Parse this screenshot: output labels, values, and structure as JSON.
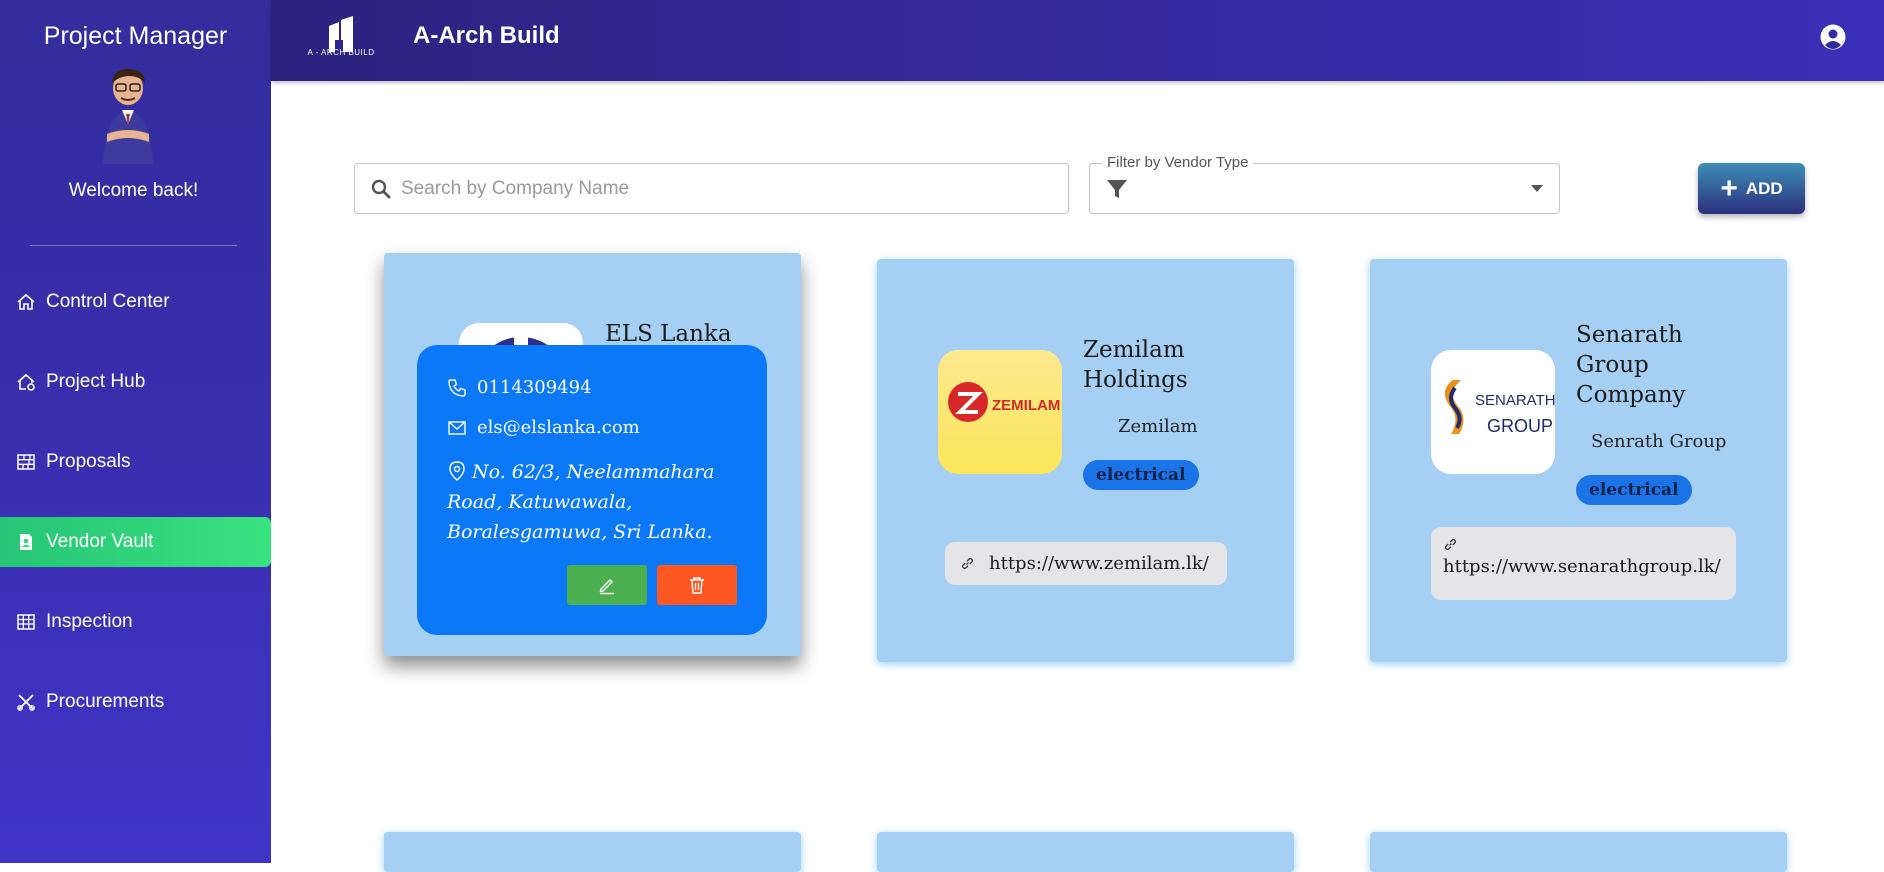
{
  "sidebar": {
    "title": "Project Manager",
    "welcome": "Welcome back!",
    "items": [
      {
        "label": "Control Center",
        "icon": "home-icon"
      },
      {
        "label": "Project Hub",
        "icon": "house-gear-icon"
      },
      {
        "label": "Proposals",
        "icon": "brick-wall-icon"
      },
      {
        "label": "Vendor Vault",
        "icon": "contact-card-icon",
        "active": true
      },
      {
        "label": "Inspection",
        "icon": "table-grid-icon"
      },
      {
        "label": "Procurements",
        "icon": "tools-icon"
      }
    ]
  },
  "header": {
    "logo_text": "A - ARCH BUILD",
    "title": "A-Arch Build"
  },
  "toolbar": {
    "search_placeholder": "Search by Company Name",
    "filter_label": "Filter by Vendor Type",
    "add_label": "ADD"
  },
  "vendors": [
    {
      "name": "ELS Lanka",
      "phone": "0114309494",
      "email": "els@elslanka.com",
      "address": "No. 62/3, Neelammahara Road, Katuwawala, Boralesgamuwa, Sri Lanka."
    },
    {
      "name": "Zemilam Holdings",
      "short": "Zemilam",
      "type": "electrical",
      "url": "https://www.zemilam.lk/",
      "logo_text": "ZEMILAM"
    },
    {
      "name": "Senarath Group Company",
      "short": "Senrath Group",
      "type": "electrical",
      "url": "https://www.senarathgroup.lk/",
      "logo_line1": "SENARATH",
      "logo_line2": "GROUP"
    }
  ],
  "colors": {
    "sidebar": "#3a2fb0",
    "active_nav": "#38e27f",
    "card": "#a5cff3",
    "overlay": "#0b78f7",
    "edit": "#4caf50",
    "delete": "#ff5722"
  }
}
